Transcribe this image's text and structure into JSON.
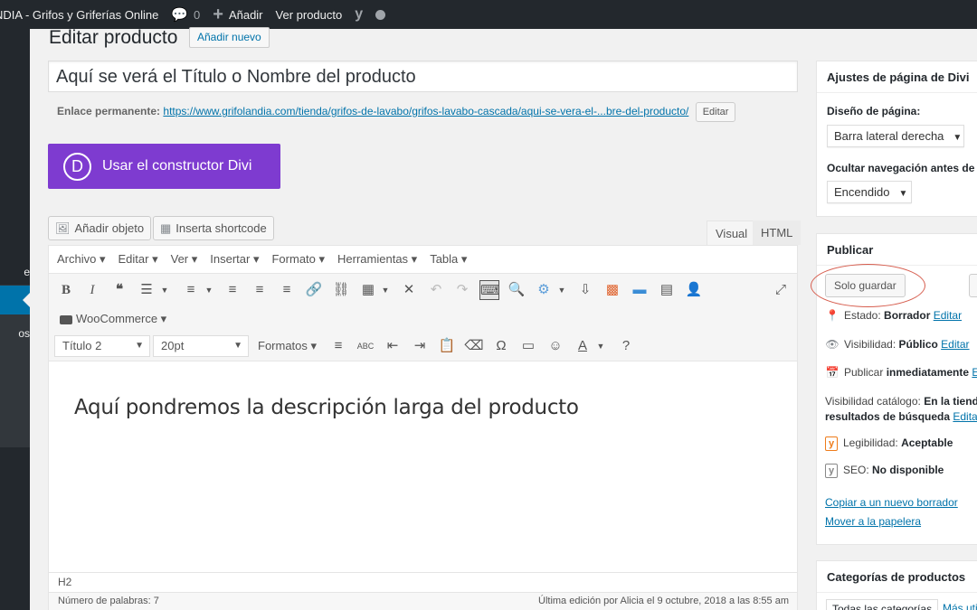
{
  "adminbar": {
    "site": "NDIA - Grifos y Griferías Online",
    "comments_count": "0",
    "add_new": "Añadir",
    "view_product": "Ver producto"
  },
  "sidebar": {
    "partial_item_1": "e",
    "partial_item_2": "os"
  },
  "header": {
    "title": "Editar producto",
    "add_new": "Añadir nuevo"
  },
  "post": {
    "title": "Aquí se verá el Título o Nombre del producto",
    "permalink_label": "Enlace permanente:",
    "permalink_url": "https://www.grifolandia.com/tienda/grifos-de-lavabo/grifos-lavabo-cascada/aqui-se-vera-el-...bre-del-producto/",
    "permalink_edit": "Editar"
  },
  "divi": {
    "logo": "D",
    "button": "Usar el constructor Divi"
  },
  "media_buttons": {
    "add_media": "Añadir objeto",
    "shortcode": "Inserta shortcode"
  },
  "editor_tabs": {
    "visual": "Visual",
    "html": "HTML"
  },
  "menubar": [
    "Archivo ▾",
    "Editar ▾",
    "Ver ▾",
    "Insertar ▾",
    "Formato ▾",
    "Herramientas ▾",
    "Tabla ▾"
  ],
  "toolbar": {
    "woocommerce": "WooCommerce ▾",
    "block_format": "Título 2",
    "font_size": "20pt",
    "formats": "Formatos ▾"
  },
  "content": {
    "text": "Aquí pondremos la descripción larga del producto",
    "path": "H2",
    "word_count": "Número de palabras: 7",
    "last_edit": "Última edición por Alicia el 9 octubre, 2018 a las 8:55 am"
  },
  "divi_settings": {
    "title": "Ajustes de página de Divi",
    "layout_label": "Diseño de página:",
    "layout_value": "Barra lateral derecha",
    "hide_nav_label": "Ocultar navegación antes de d",
    "hide_nav_value": "Encendido"
  },
  "publish": {
    "title": "Publicar",
    "save_draft": "Solo guardar",
    "status_label": "Estado: ",
    "status_value": "Borrador",
    "status_edit": "Editar",
    "visibility_label": "Visibilidad: ",
    "visibility_value": "Público",
    "visibility_edit": "Editar",
    "publish_label": "Publicar ",
    "publish_value": "inmediatamente",
    "publish_edit": "E",
    "catalog_label": "Visibilidad catálogo: ",
    "catalog_value": "En la tiend",
    "catalog_line2": "resultados de búsqueda",
    "catalog_edit": "Editar",
    "readability_label": "Legibilidad: ",
    "readability_value": "Aceptable",
    "seo_label": "SEO: ",
    "seo_value": "No disponible",
    "copy_draft": "Copiar a un nuevo borrador",
    "trash": "Mover a la papelera"
  },
  "categories": {
    "title": "Categorías de productos",
    "tab_all": "Todas las categorías",
    "tab_most_used": "Más uti"
  },
  "colors": {
    "divi_purple": "#7e3bd0",
    "link_blue": "#0073aa",
    "highlight_circle": "#d65c4d",
    "trash_red": "#aa0000"
  }
}
